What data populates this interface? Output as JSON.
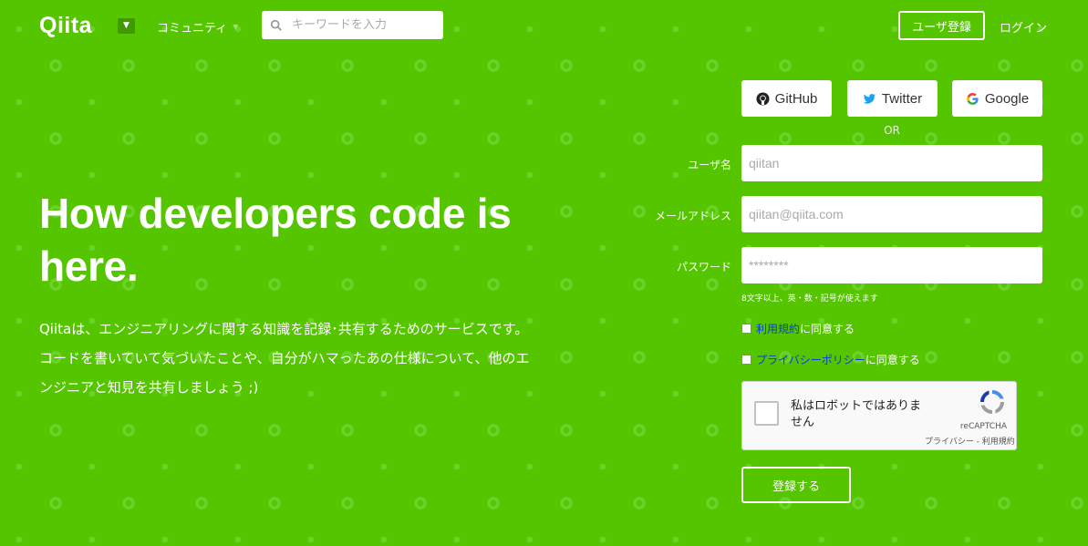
{
  "header": {
    "logo": "Qiita",
    "community_label": "コミュニティ",
    "search_placeholder": "キーワードを入力",
    "signup_label": "ユーザ登録",
    "login_label": "ログイン"
  },
  "hero": {
    "title": "How developers code is here.",
    "description": [
      "Qiitaは、エンジニアリングに関する知識を記録･共有するためのサービスです。",
      "コードを書いていて気づいたことや、自分がハマったあの仕様について、他のエ",
      "ンジニアと知見を共有しましょう ;)"
    ]
  },
  "oauth": {
    "github": "GitHub",
    "twitter": "Twitter",
    "google": "Google",
    "or": "OR"
  },
  "form": {
    "username_label": "ユーザ名",
    "username_placeholder": "qiitan",
    "email_label": "メールアドレス",
    "email_placeholder": "qiitan@qiita.com",
    "password_label": "パスワード",
    "password_placeholder": "********",
    "password_hint": "8文字以上、英・数・記号が使えます",
    "terms_link": "利用規約",
    "terms_suffix": "に同意する",
    "privacy_link": "プライバシーポリシー",
    "privacy_suffix": "に同意する",
    "submit_label": "登録する"
  },
  "recaptcha": {
    "label": "私はロボットではありません",
    "brand": "reCAPTCHA",
    "links": "プライバシー - 利用規約"
  },
  "colors": {
    "background": "#55c500",
    "link": "#0a3dd6",
    "google_red": "#ea4335",
    "twitter_blue": "#1da1f2"
  }
}
